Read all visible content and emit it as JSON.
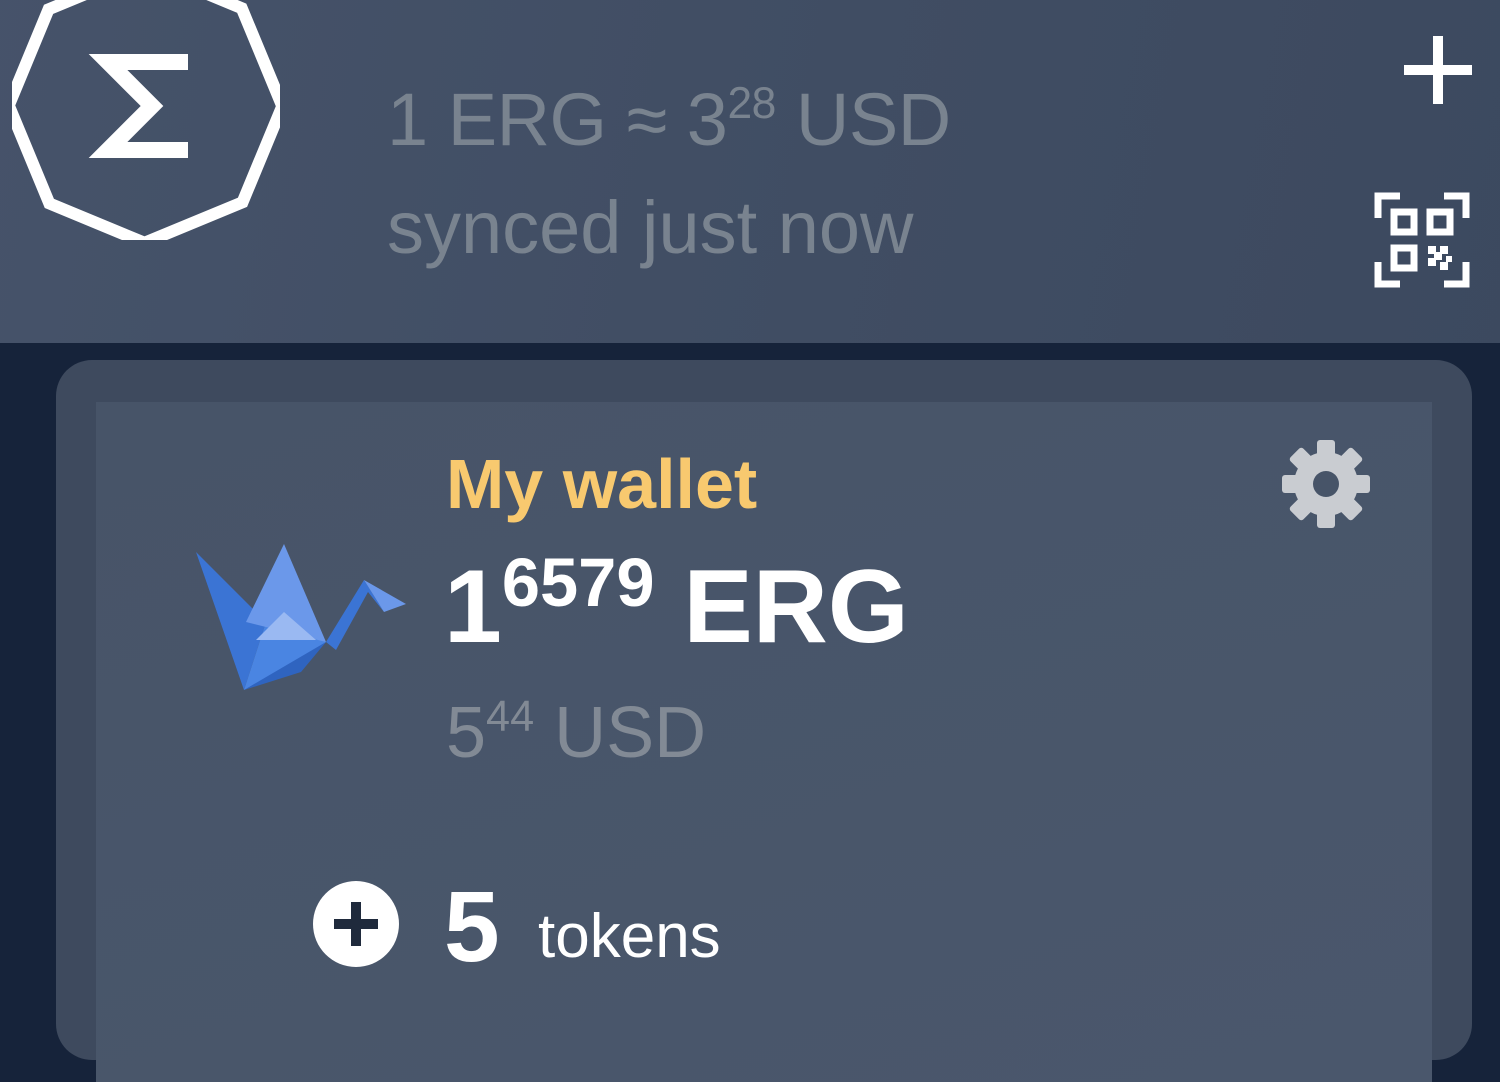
{
  "header": {
    "rate": {
      "prefix": "1 ERG ≈ 3",
      "decimals": "28",
      "currency": "USD"
    },
    "sync_status": "synced just now",
    "icons": {
      "logo": "ergo-sigma-logo",
      "add": "plus-icon",
      "scan": "qr-scan-icon"
    }
  },
  "wallet": {
    "name": "My wallet",
    "balance": {
      "integer": "1",
      "decimals": "6579",
      "unit": "ERG"
    },
    "fiat": {
      "integer": "5",
      "decimals": "44",
      "currency": "USD"
    },
    "tokens": {
      "count": "5",
      "label": "tokens"
    },
    "icons": {
      "wallet": "origami-crane-icon",
      "settings": "gear-icon",
      "expand": "plus-circle-icon"
    }
  },
  "colors": {
    "background": "#16233a",
    "header": "#434f65",
    "card": "#475468",
    "accent": "#f8c96f",
    "muted_text": "#79838f",
    "wallet_icon_blue": "#3b74d4"
  }
}
